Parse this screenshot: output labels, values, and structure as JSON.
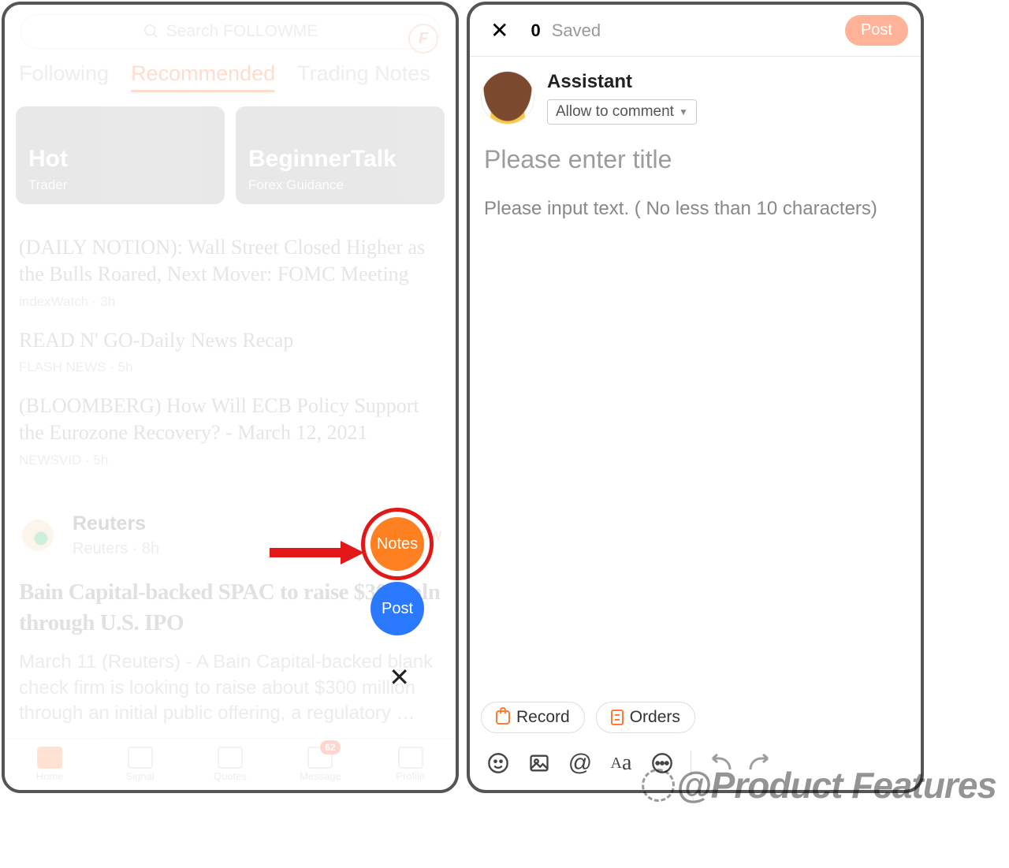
{
  "left": {
    "search_placeholder": "Search FOLLOWME",
    "tabs": {
      "following": "Following",
      "recommended": "Recommended",
      "trading": "Trading Notes"
    },
    "cards": {
      "hot": {
        "title": "Hot",
        "sub": "Trader"
      },
      "beg": {
        "title": "BeginnerTalk",
        "sub": "Forex Guidance"
      }
    },
    "feed": {
      "a_title": "(DAILY NOTION): Wall Street Closed Higher as the Bulls Roared, Next Mover: FOMC Meeting",
      "a_meta": "indexWatch · 3h",
      "b_title": "READ N' GO-Daily News Recap",
      "b_meta": "FLASH NEWS · 5h",
      "c_title": "(BLOOMBERG) How Will ECB Policy Support the Eurozone Recovery? - March 12, 2021",
      "c_meta": "NEWSVID · 5h"
    },
    "reuters": {
      "name": "Reuters",
      "sub": "Reuters · 8h",
      "follow": "+Follow"
    },
    "bain": {
      "headline": "Bain Capital-backed SPAC to raise $300 mln through U.S. IPO",
      "body": "March 11 (Reuters) - A Bain Capital-backed blank check firm is looking to raise about $300 million through an initial public offering, a regulatory …"
    },
    "fab": {
      "notes": "Notes",
      "post": "Post"
    },
    "nav": {
      "home": "Home",
      "signal": "Signal",
      "quotes": "Quotes",
      "message": "Message",
      "profile": "Profile",
      "badge": "62"
    }
  },
  "right": {
    "count": "0",
    "saved": "Saved",
    "post": "Post",
    "author": {
      "name": "Assistant",
      "comment": "Allow to comment"
    },
    "title_ph": "Please enter title",
    "body_ph": "Please input text. ( No less than 10 characters)",
    "pills": {
      "record": "Record",
      "orders": "Orders"
    }
  },
  "watermark": "@Product Features"
}
